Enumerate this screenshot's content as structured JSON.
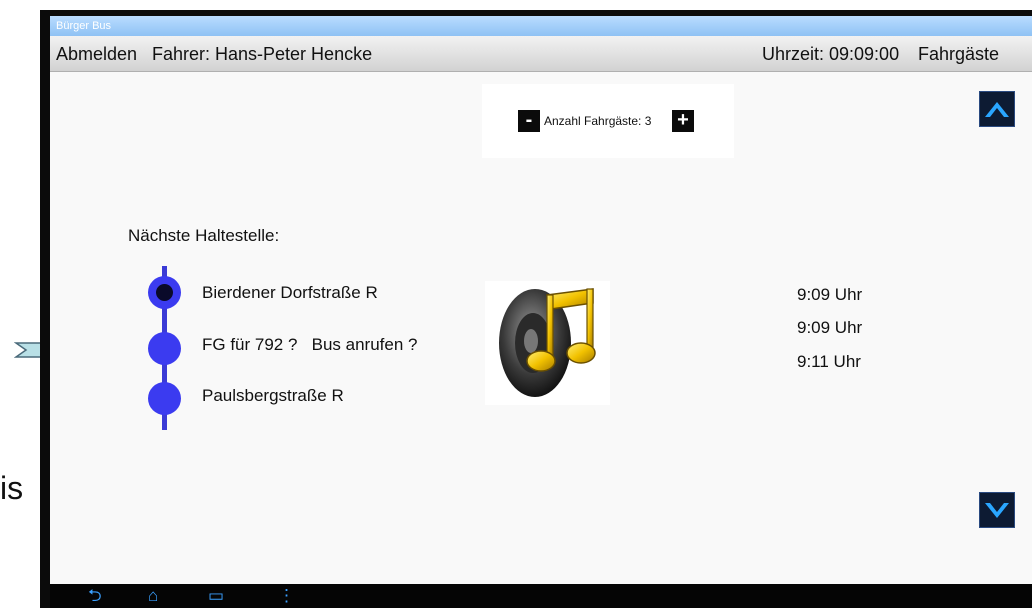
{
  "window": {
    "title": "Bürger Bus"
  },
  "header": {
    "logout_label": "Abmelden",
    "driver_label": "Fahrer: Hans-Peter Hencke",
    "clock_label": "Uhrzeit: 09:09:00",
    "passengers_tab": "Fahrgäste"
  },
  "counter": {
    "minus_label": "-",
    "plus_label": "+",
    "count_label": "Anzahl Fahrgäste: 3"
  },
  "route": {
    "title": "Nächste Haltestelle:",
    "stops": [
      {
        "name": "Bierdener Dorfstraße R",
        "time": "9:09 Uhr"
      },
      {
        "name": "FG für 792 ?   Bus anrufen ?",
        "time": "9:09 Uhr"
      },
      {
        "name": "Paulsbergstraße R",
        "time": "9:11 Uhr"
      }
    ]
  },
  "sound": {
    "icon": "speaker-music-note-icon"
  },
  "nav": {
    "icons": [
      "back-icon",
      "home-icon",
      "recent-apps-icon",
      "menu-icon"
    ]
  },
  "outside": {
    "cut_text": "is"
  },
  "colors": {
    "route_blue": "#3b3bf0",
    "header_gray": "#d2d2d2",
    "titlebar_blue": "#8fc2f4",
    "arrow_fill": "#b9e0e6"
  }
}
